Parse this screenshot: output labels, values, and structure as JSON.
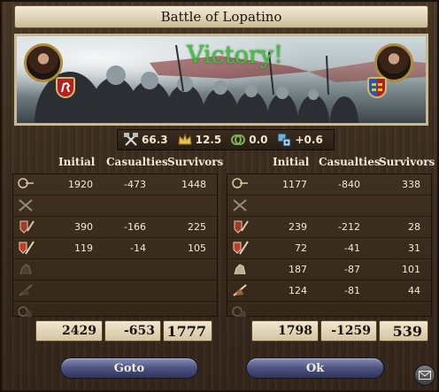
{
  "window": {
    "title": "Battle of Lopatino"
  },
  "banner": {
    "result": "Victory!"
  },
  "stats": [
    {
      "icon": "crossed-axes-icon",
      "value": "66.3"
    },
    {
      "icon": "crown-icon",
      "value": "12.5"
    },
    {
      "icon": "knot-icon",
      "value": "0.0"
    },
    {
      "icon": "dice-icon",
      "value": "+0.6"
    }
  ],
  "columns": {
    "initial": "Initial",
    "casualties": "Casualties",
    "survivors": "Survivors"
  },
  "left_side": {
    "rows": [
      {
        "unit": "archer-icon",
        "initial": "1920",
        "casualties": "-473",
        "survivors": "1448"
      },
      {
        "unit": "light-infantry-icon",
        "initial": "",
        "casualties": "",
        "survivors": ""
      },
      {
        "unit": "heavy-infantry-icon",
        "initial": "390",
        "casualties": "-166",
        "survivors": "225"
      },
      {
        "unit": "pikemen-icon",
        "initial": "119",
        "casualties": "-14",
        "survivors": "105"
      },
      {
        "unit": "light-cavalry-icon",
        "initial": "",
        "casualties": "",
        "survivors": ""
      },
      {
        "unit": "knights-icon",
        "initial": "",
        "casualties": "",
        "survivors": ""
      },
      {
        "unit": "horse-archers-icon",
        "initial": "",
        "casualties": "",
        "survivors": ""
      }
    ],
    "totals": {
      "initial": "2429",
      "casualties": "-653",
      "survivors": "1777"
    }
  },
  "right_side": {
    "rows": [
      {
        "unit": "archer-icon",
        "initial": "1177",
        "casualties": "-840",
        "survivors": "338"
      },
      {
        "unit": "light-infantry-icon",
        "initial": "",
        "casualties": "",
        "survivors": ""
      },
      {
        "unit": "heavy-infantry-icon",
        "initial": "239",
        "casualties": "-212",
        "survivors": "28"
      },
      {
        "unit": "pikemen-icon",
        "initial": "72",
        "casualties": "-41",
        "survivors": "31"
      },
      {
        "unit": "light-cavalry-icon",
        "initial": "187",
        "casualties": "-87",
        "survivors": "101"
      },
      {
        "unit": "knights-icon",
        "initial": "124",
        "casualties": "-81",
        "survivors": "44"
      },
      {
        "unit": "horse-archers-icon",
        "initial": "",
        "casualties": "",
        "survivors": ""
      }
    ],
    "totals": {
      "initial": "1798",
      "casualties": "-1259",
      "survivors": "539"
    }
  },
  "buttons": {
    "goto": "Goto",
    "ok": "Ok"
  },
  "colors": {
    "victory": "#42c440",
    "button": "#4d5380",
    "parchment": "#e8dcc0"
  }
}
